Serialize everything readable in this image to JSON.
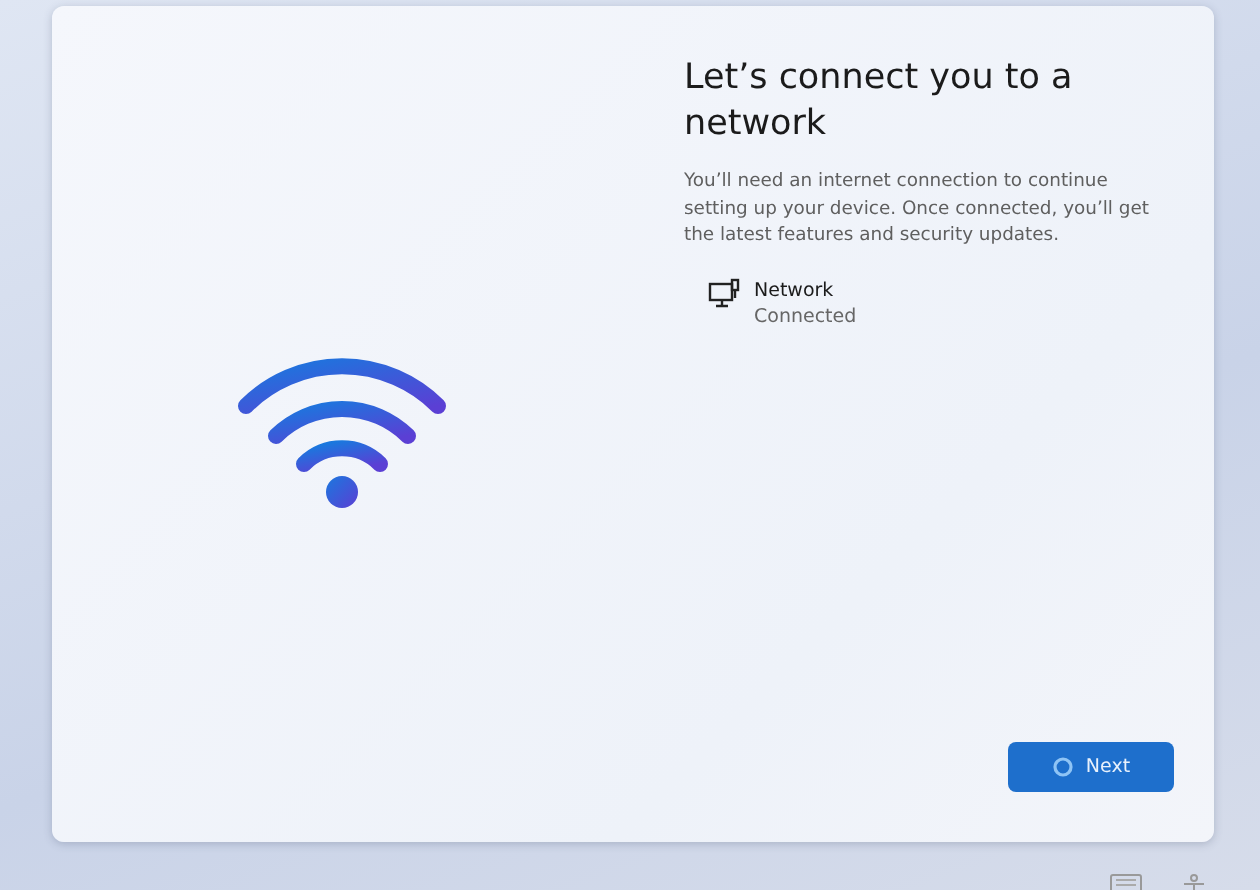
{
  "heading": "Let’s connect you to a network",
  "description": "You’ll need an internet connection to continue setting up your device. Once connected, you’ll get the latest features and security updates.",
  "networks": [
    {
      "name": "Network",
      "status": "Connected"
    }
  ],
  "next_button": {
    "label": "Next",
    "loading": true
  }
}
